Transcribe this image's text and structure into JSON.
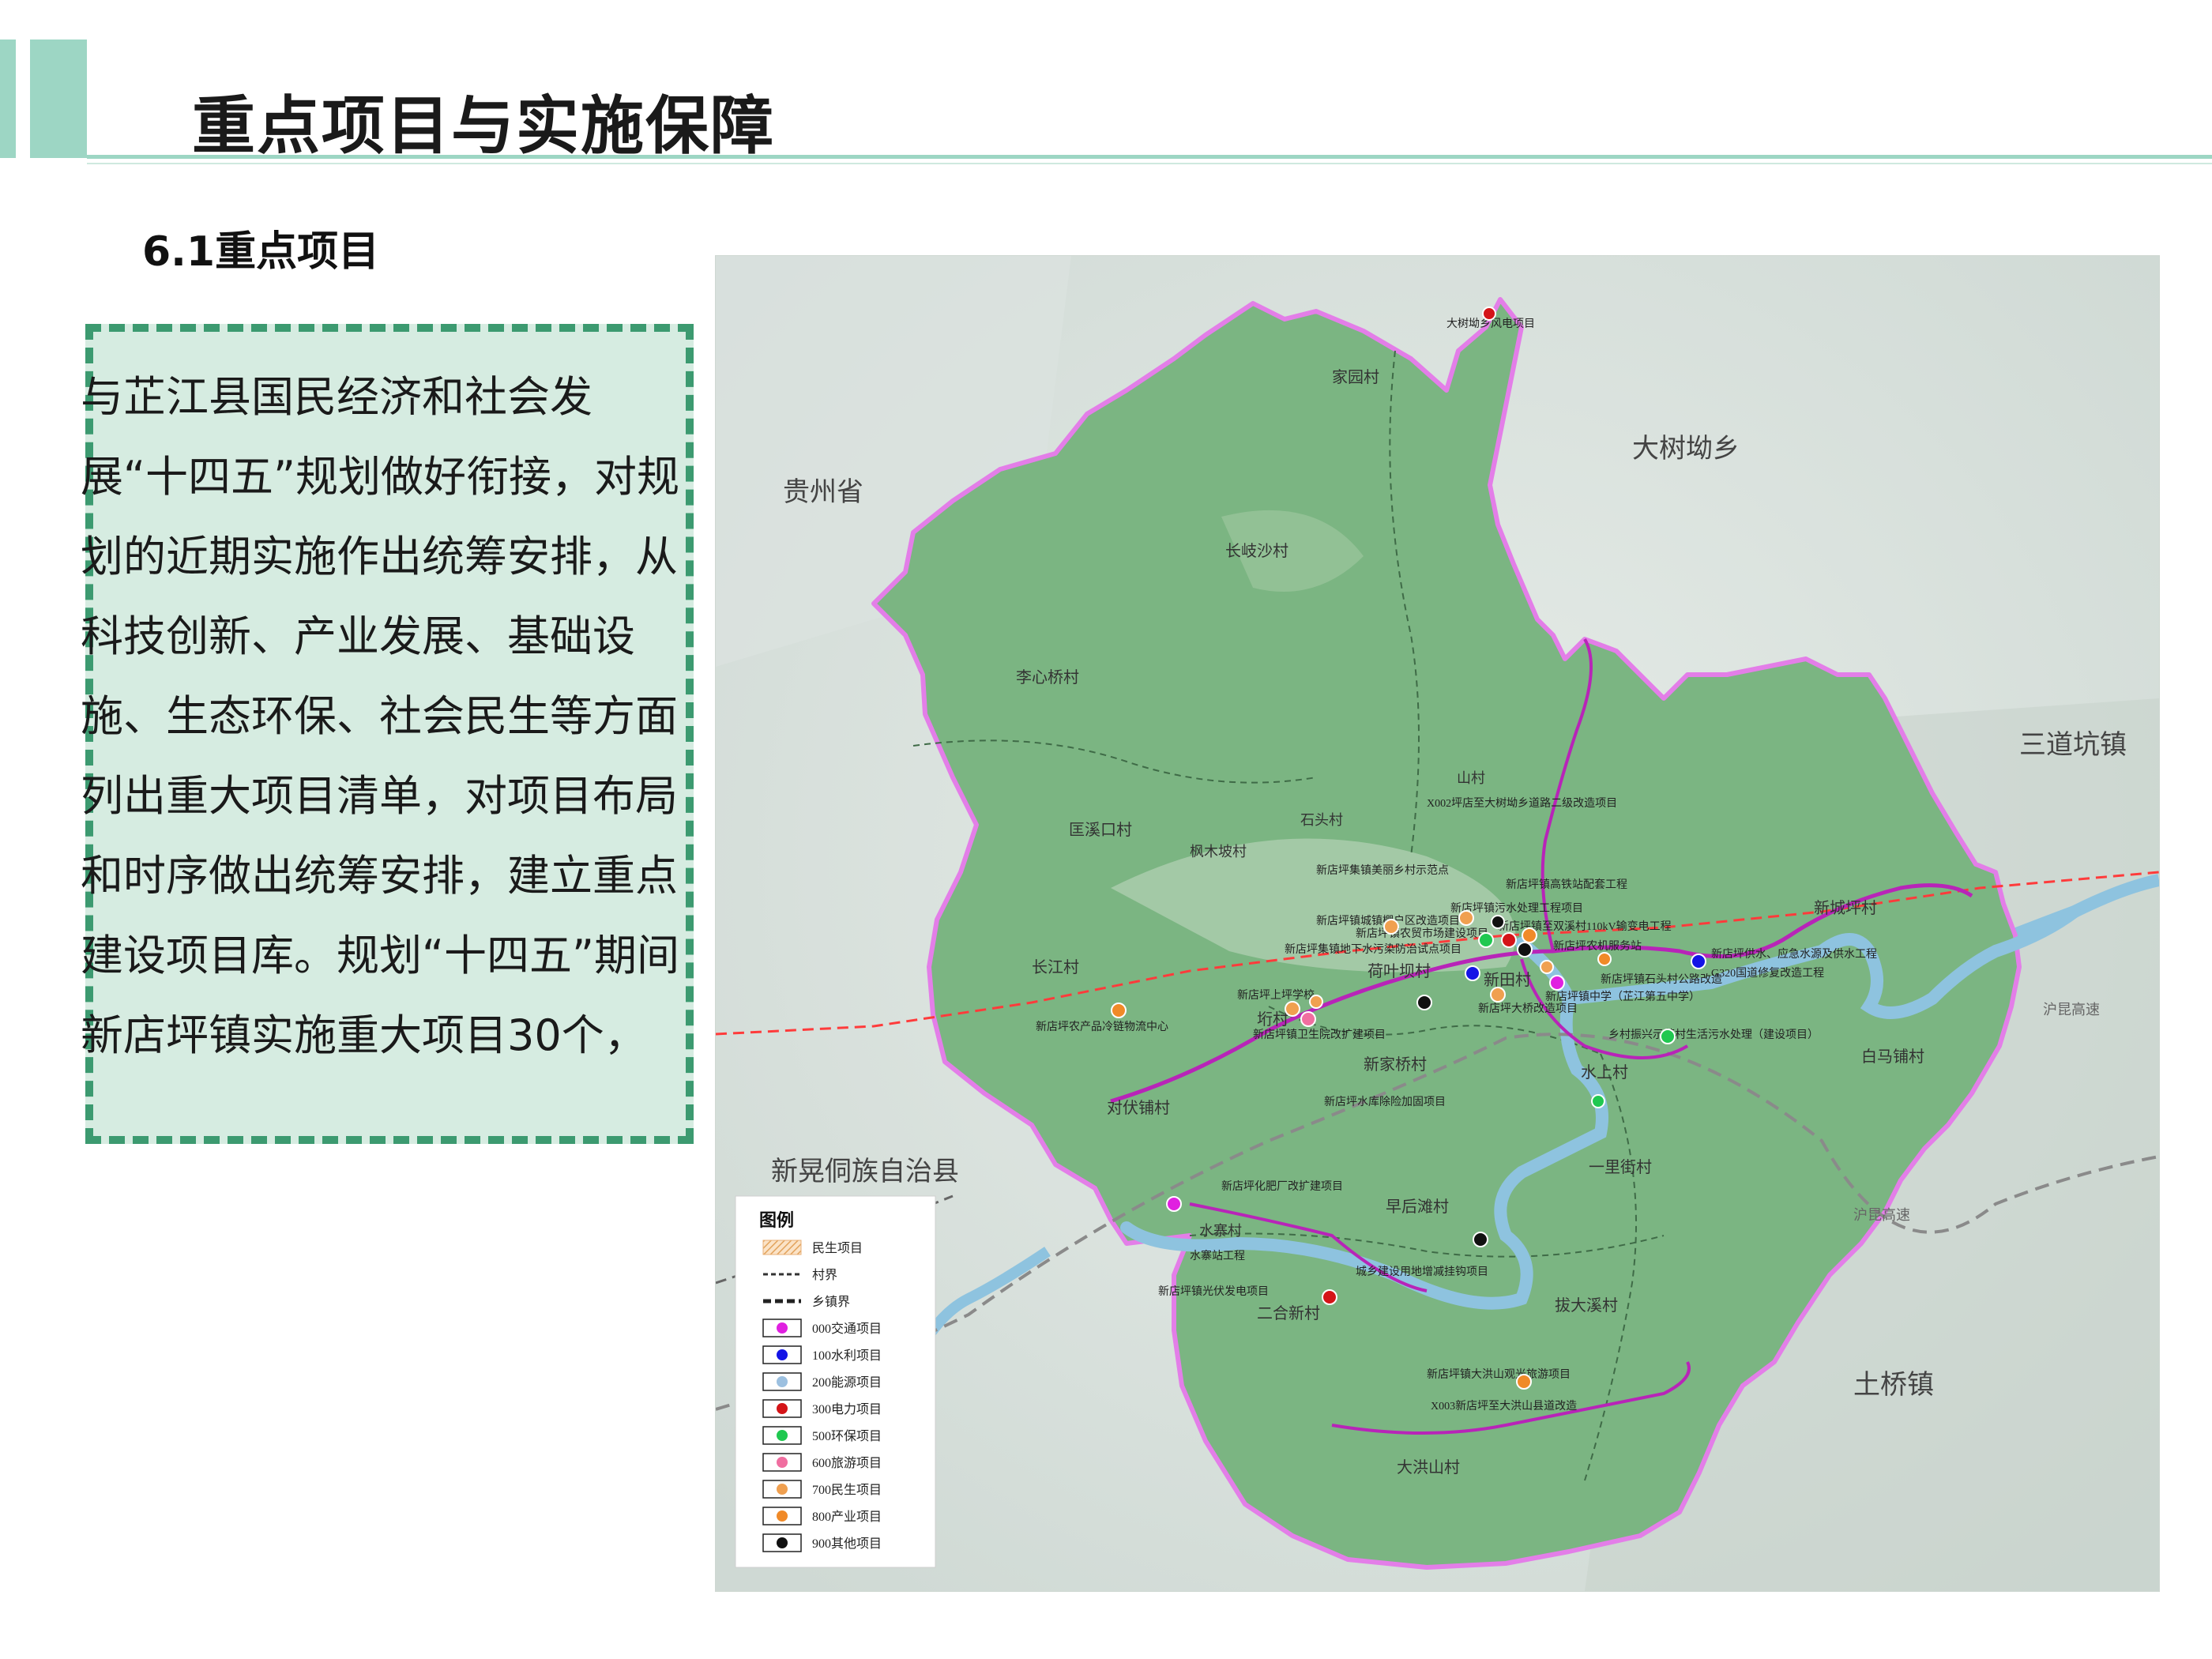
{
  "header": {
    "title": "重点项目与实施保障"
  },
  "section": {
    "title": "6.1重点项目"
  },
  "body": {
    "text": "与芷江县国民经济和社会发展“十四五”规划做好衔接，对规划的近期实施作出统筹安排，从科技创新、产业发展、基础设施、生态环保、社会民生等方面列出重大项目清单，对项目布局和时序做出统筹安排，建立重点建设项目库。规划“十四五”期间新店坪镇实施重大项目30个，"
  },
  "map": {
    "region_labels": [
      "贵州省",
      "大树坳乡",
      "三道坑镇",
      "新晃侗族自治县",
      "土桥镇"
    ],
    "village_labels": [
      "家园村",
      "长岐沙村",
      "李心桥村",
      "匡溪口村",
      "长江村",
      "对伏铺村",
      "荷叶坝村",
      "新田村",
      "新家桥村",
      "水上村",
      "白马铺村",
      "新城坪村",
      "一里街村",
      "早后滩村",
      "二合新村",
      "拔大溪村",
      "大洪山村",
      "垳村",
      "山村",
      "枫木坡村",
      "石头村",
      "水寨村"
    ],
    "highway_labels": [
      "沪昆高速",
      "沪昆高速"
    ],
    "project_labels": [
      "大树坳乡风电项目",
      "X002坪店至大树坳乡道路二级改造项目",
      "新店坪镇污水处理工程项目",
      "新店坪镇农贸市场建设项目",
      "新店坪镇城镇棚户区改造项目",
      "新店坪镇至双溪村110kV输变电工程",
      "新店坪集镇地下水污染防治试点项目",
      "新店坪上坪学校",
      "新店坪镇卫生院改扩建项目",
      "新店坪集镇美丽乡村示范点",
      "新店坪镇高铁站配套工程",
      "新店坪农机服务站",
      "新店坪供水、应急水源及供水工程",
      "G320国道修复改造工程",
      "新店坪镇石头村公路改造",
      "新店坪大桥改造项目",
      "新店坪镇中学（芷江第五中学）",
      "乡村振兴示范村生活污水处理（建设项目）",
      "新店坪农产品冷链物流中心",
      "水寨站工程",
      "城乡建设用地增减挂钩项目",
      "新店坪镇光伏发电项目",
      "新店坪化肥厂改扩建项目",
      "新店坪水库除险加固项目",
      "X003新店坪至大洪山县道改造",
      "新店坪镇大洪山观光旅游项目"
    ],
    "legend": {
      "title": "图例",
      "items": [
        {
          "label": "民生项目",
          "kind": "hatch",
          "color": "#e8b27a"
        },
        {
          "label": "村界",
          "kind": "dash-thin",
          "color": "#333333"
        },
        {
          "label": "乡镇界",
          "kind": "dash-thick",
          "color": "#222222"
        },
        {
          "label": "000交通项目",
          "kind": "dot",
          "color": "#e020e0"
        },
        {
          "label": "100水利项目",
          "kind": "dot",
          "color": "#1414e6"
        },
        {
          "label": "200能源项目",
          "kind": "dot",
          "color": "#9cc0e0"
        },
        {
          "label": "300电力项目",
          "kind": "dot",
          "color": "#d41418"
        },
        {
          "label": "500环保项目",
          "kind": "dot",
          "color": "#20c850"
        },
        {
          "label": "600旅游项目",
          "kind": "dot",
          "color": "#f06ea0"
        },
        {
          "label": "700民生项目",
          "kind": "dot",
          "color": "#f0a050"
        },
        {
          "label": "800产业项目",
          "kind": "dot",
          "color": "#f08a28"
        },
        {
          "label": "900其他项目",
          "kind": "dot",
          "color": "#111111"
        }
      ]
    },
    "colors": {
      "town": "#7bb582",
      "boundary": "#e37ee8",
      "river": "#8ec3df",
      "railway": "#ff3b3b",
      "road": "#b824b8"
    }
  }
}
